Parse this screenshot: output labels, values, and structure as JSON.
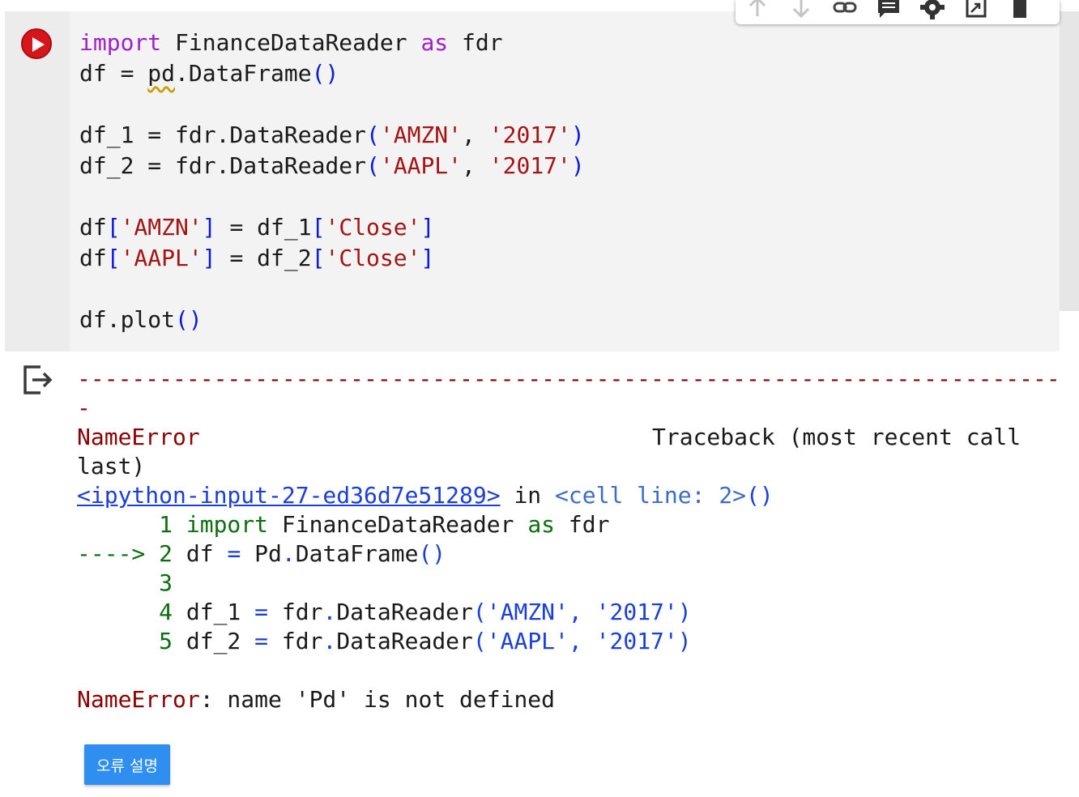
{
  "toolbar": {
    "icons": [
      "arrow-up-icon",
      "arrow-down-icon",
      "link-icon",
      "comment-icon",
      "gear-icon",
      "mirror-cell-icon",
      "delete-icon"
    ]
  },
  "cell": {
    "code": {
      "l1": {
        "kw1": "import",
        "mod": " FinanceDataReader ",
        "kw2": "as",
        "alias": " fdr"
      },
      "l2": {
        "pre": "df = ",
        "pd": "pd",
        "post": ".DataFrame",
        "parens": "()"
      },
      "l4": {
        "pre": "df_1 = fdr.DataReader",
        "open": "(",
        "s1": "'AMZN'",
        "comma": ", ",
        "s2": "'2017'",
        "close": ")"
      },
      "l5": {
        "pre": "df_2 = fdr.DataReader",
        "open": "(",
        "s1": "'AAPL'",
        "comma": ", ",
        "s2": "'2017'",
        "close": ")"
      },
      "l7": {
        "pre": "df",
        "ob1": "[",
        "s1": "'AMZN'",
        "cb1": "]",
        "mid": " = df_1",
        "ob2": "[",
        "s2": "'Close'",
        "cb2": "]"
      },
      "l8": {
        "pre": "df",
        "ob1": "[",
        "s1": "'AAPL'",
        "cb1": "]",
        "mid": " = df_2",
        "ob2": "[",
        "s2": "'Close'",
        "cb2": "]"
      },
      "l10": {
        "pre": "df.plot",
        "parens": "()"
      }
    }
  },
  "output": {
    "dashes": "---------------------------------------------------------------------------",
    "dash_tail": "-",
    "error_name": "NameError",
    "traceback_label": "Traceback (most recent call",
    "traceback_cont": "last)",
    "input_link": "<ipython-input-27-ed36d7e51289>",
    "in_word": " in ",
    "cell_ref": "<cell line: 2>",
    "cell_ref_parens": "()",
    "tb1": {
      "num": "      1 ",
      "kw1": "import",
      "mod": " FinanceDataReader ",
      "kw2": "as",
      "alias": " fdr"
    },
    "tb2": {
      "arrow": "----> 2 ",
      "pre": "df ",
      "eq": "=",
      "mid": " Pd",
      "dot": ".",
      "post": "DataFrame",
      "parens": "()"
    },
    "tb3": {
      "num": "      3"
    },
    "tb4": {
      "num": "      4 ",
      "pre": "df_1 ",
      "eq": "=",
      "mid": " fdr",
      "dot": ".",
      "post": "DataReader",
      "open": "(",
      "s1": "'AMZN'",
      "comma": ", ",
      "s2": "'2017'",
      "close": ")"
    },
    "tb5": {
      "num": "      5 ",
      "pre": "df_2 ",
      "eq": "=",
      "mid": " fdr",
      "dot": ".",
      "post": "DataReader",
      "open": "(",
      "s1": "'AAPL'",
      "comma": ", ",
      "s2": "'2017'",
      "close": ")"
    },
    "final_error_name": "NameError",
    "final_error_msg": ": name 'Pd' is not defined",
    "explain_button": "오류 설명"
  }
}
